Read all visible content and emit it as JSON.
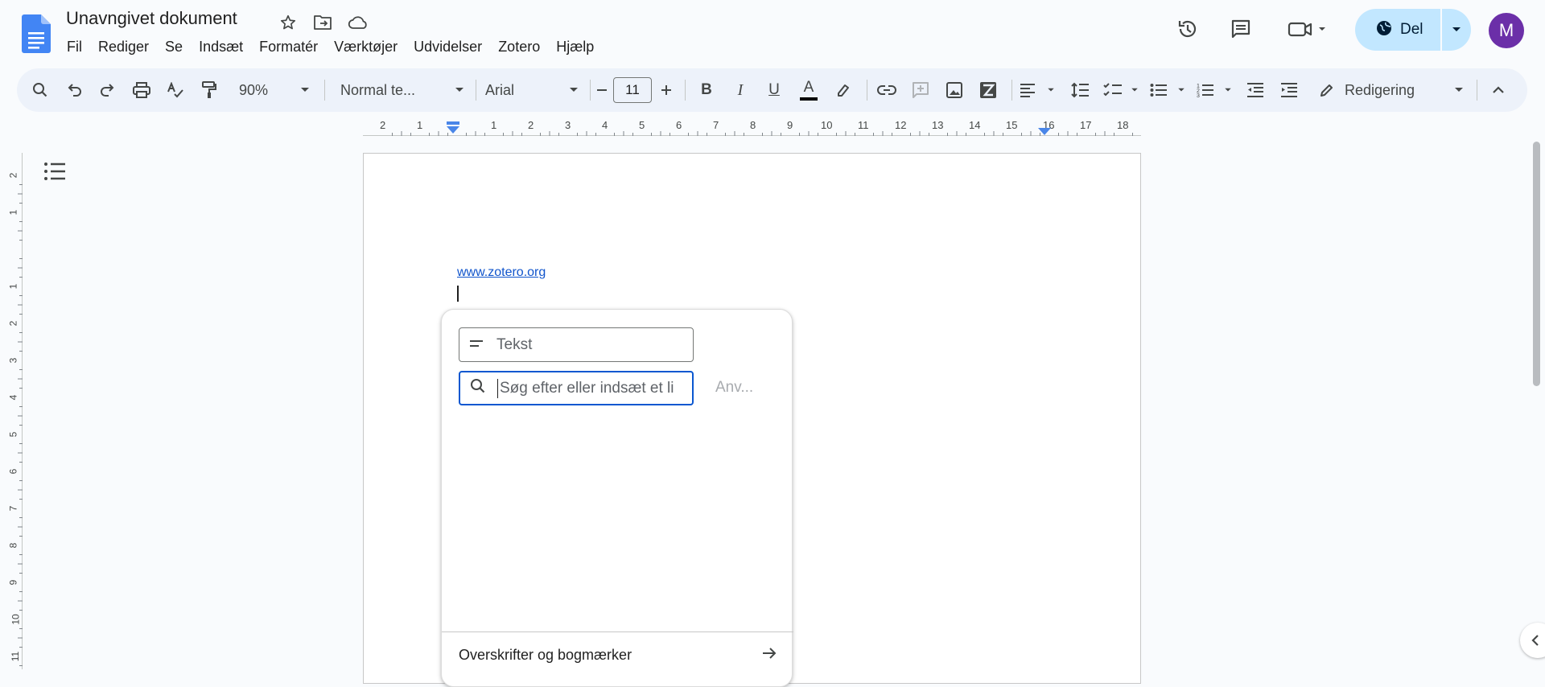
{
  "header": {
    "doc_title": "Unavngivet dokument",
    "share_label": "Del",
    "avatar_initial": "M"
  },
  "menu": [
    "Fil",
    "Rediger",
    "Se",
    "Indsæt",
    "Formatér",
    "Værktøjer",
    "Udvidelser",
    "Zotero",
    "Hjælp"
  ],
  "toolbar": {
    "zoom": "90%",
    "style": "Normal te...",
    "font": "Arial",
    "font_size": "11",
    "mode": "Redigering"
  },
  "ruler": {
    "horizontal": [
      "2",
      "1",
      "1",
      "2",
      "3",
      "4",
      "5",
      "6",
      "7",
      "8",
      "9",
      "10",
      "11",
      "12",
      "13",
      "14",
      "15",
      "16",
      "17",
      "18"
    ],
    "vertical": [
      "2",
      "1",
      "1",
      "2",
      "3",
      "4",
      "5",
      "6",
      "7",
      "8",
      "9",
      "10",
      "11"
    ]
  },
  "document": {
    "link_text": "www.zotero.org"
  },
  "link_popup": {
    "text_placeholder": "Tekst",
    "url_placeholder": "Søg efter eller indsæt et li",
    "apply_label": "Anv...",
    "headings_label": "Overskrifter og bogmærker"
  },
  "colors": {
    "accent": "#0b57d0",
    "share_bg": "#c2e7ff",
    "avatar_bg": "#6b2fa8",
    "toolbar_bg": "#edf2fa",
    "link": "#1155cc"
  }
}
